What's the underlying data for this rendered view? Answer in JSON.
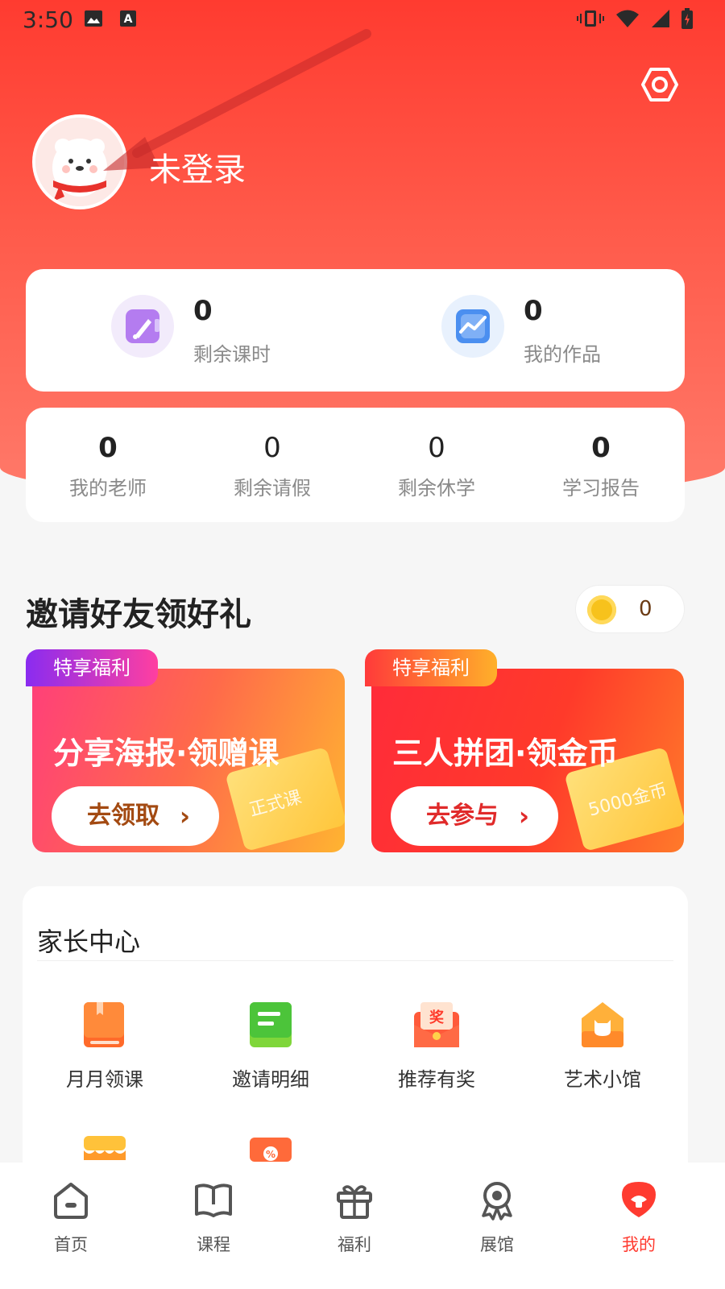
{
  "status_bar": {
    "time": "3:50"
  },
  "profile": {
    "username": "未登录"
  },
  "stats_primary": [
    {
      "value": "0",
      "label": "剩余课时",
      "icon": "pencil-icon"
    },
    {
      "value": "0",
      "label": "我的作品",
      "icon": "chart-icon"
    }
  ],
  "stats_secondary": [
    {
      "value": "0",
      "label": "我的老师"
    },
    {
      "value": "0",
      "label": "剩余请假"
    },
    {
      "value": "0",
      "label": "剩余休学"
    },
    {
      "value": "0",
      "label": "学习报告"
    }
  ],
  "invite": {
    "title": "邀请好友领好礼",
    "coins": "0",
    "promos": [
      {
        "tag": "特享福利",
        "headline": "分享海报·领赠课",
        "cta": "去领取",
        "ticket_text": "正式课",
        "accent": "#ff4a7a"
      },
      {
        "tag": "特享福利",
        "headline": "三人拼团·领金币",
        "cta": "去参与",
        "ticket_text": "5000金币",
        "accent": "#ff2a2a"
      }
    ]
  },
  "parents_center": {
    "title": "家长中心",
    "items": [
      {
        "label": "月月领课",
        "icon": "book-icon"
      },
      {
        "label": "邀请明细",
        "icon": "document-icon"
      },
      {
        "label": "推荐有奖",
        "icon": "prize-envelope-icon"
      },
      {
        "label": "艺术小馆",
        "icon": "shop-icon"
      }
    ]
  },
  "tabbar": [
    {
      "label": "首页",
      "icon": "home-icon"
    },
    {
      "label": "课程",
      "icon": "open-book-icon"
    },
    {
      "label": "福利",
      "icon": "gift-icon"
    },
    {
      "label": "展馆",
      "icon": "award-icon"
    },
    {
      "label": "我的",
      "icon": "profile-icon",
      "active": true
    }
  ],
  "colors": {
    "primary": "#ff3b30",
    "cta_brown": "#a34a12",
    "cta_red": "#e02a2a"
  }
}
